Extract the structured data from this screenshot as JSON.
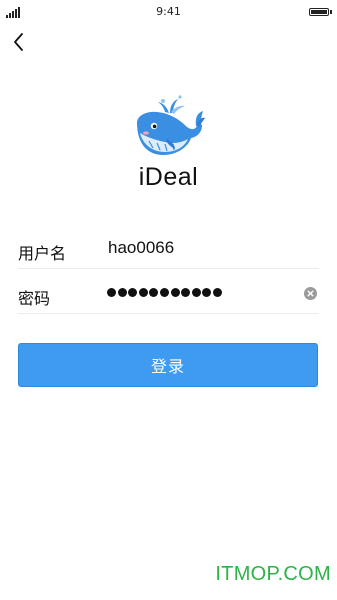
{
  "status_bar": {
    "time": "9:41",
    "signal_icon": "cellular-signal-icon",
    "battery_icon": "battery-icon",
    "battery_level": 1.0
  },
  "nav": {
    "back_icon": "chevron-left-icon"
  },
  "app": {
    "name": "iDeal",
    "logo_icon": "whale-logo-icon"
  },
  "form": {
    "username_label": "用户名",
    "username_value": "hao0066",
    "password_label": "密码",
    "password_mask_count": 11,
    "clear_icon": "clear-circle-icon"
  },
  "login_button": {
    "label": "登录"
  },
  "watermark": "ITMOP.COM",
  "colors": {
    "primary": "#3e9bef",
    "whale_blue": "#3a8fe3",
    "watermark_green": "#2eb34a"
  }
}
